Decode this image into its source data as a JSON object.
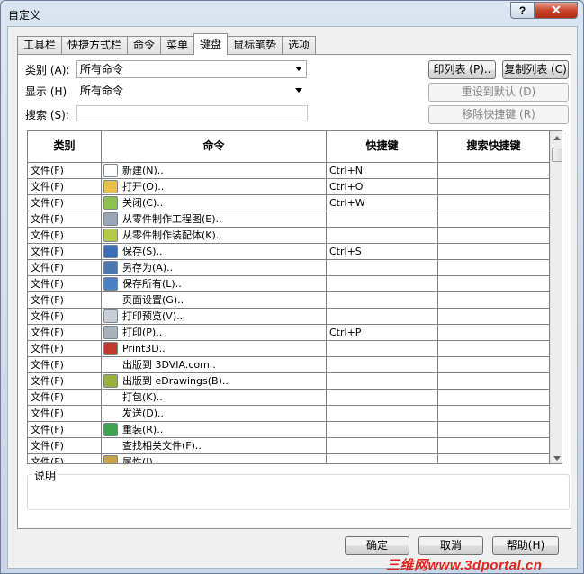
{
  "window": {
    "title": "自定义",
    "help_label": "?",
    "close_label": "✕"
  },
  "tabs": [
    {
      "label": "工具栏"
    },
    {
      "label": "快捷方式栏"
    },
    {
      "label": "命令"
    },
    {
      "label": "菜单"
    },
    {
      "label": "键盘"
    },
    {
      "label": "鼠标笔势"
    },
    {
      "label": "选项"
    }
  ],
  "active_tab_index": 4,
  "filters": {
    "category_label": "类别 (A):",
    "category_value": "所有命令",
    "show_label": "显示 (H)",
    "show_value": "所有命令",
    "search_label": "搜索 (S):",
    "search_value": ""
  },
  "buttons": {
    "print_list": "印列表 (P)..",
    "copy_list": "复制列表 (C)",
    "reset_default": "重设到默认 (D)",
    "remove_shortcut": "移除快捷键 (R)",
    "ok": "确定",
    "cancel": "取消",
    "help": "帮助(H)"
  },
  "table": {
    "headers": [
      "类别",
      "命令",
      "快捷键",
      "搜索快捷键"
    ],
    "rows": [
      {
        "category": "文件(F)",
        "command": "新建(N)..",
        "shortcut": "Ctrl+N",
        "search": "",
        "icon": "new-document-icon",
        "color": "#ffffff"
      },
      {
        "category": "文件(F)",
        "command": "打开(O)..",
        "shortcut": "Ctrl+O",
        "search": "",
        "icon": "open-folder-icon",
        "color": "#e8c04a"
      },
      {
        "category": "文件(F)",
        "command": "关闭(C)..",
        "shortcut": "Ctrl+W",
        "search": "",
        "icon": "close-folder-icon",
        "color": "#8dc04c"
      },
      {
        "category": "文件(F)",
        "command": "从零件制作工程图(E)..",
        "shortcut": "",
        "search": "",
        "icon": "make-drawing-icon",
        "color": "#9aa6b4"
      },
      {
        "category": "文件(F)",
        "command": "从零件制作装配体(K)..",
        "shortcut": "",
        "search": "",
        "icon": "make-assembly-icon",
        "color": "#b5c94a"
      },
      {
        "category": "文件(F)",
        "command": "保存(S)..",
        "shortcut": "Ctrl+S",
        "search": "",
        "icon": "save-icon",
        "color": "#3a6fb8"
      },
      {
        "category": "文件(F)",
        "command": "另存为(A)..",
        "shortcut": "",
        "search": "",
        "icon": "save-as-icon",
        "color": "#4a78b0"
      },
      {
        "category": "文件(F)",
        "command": "保存所有(L)..",
        "shortcut": "",
        "search": "",
        "icon": "save-all-icon",
        "color": "#4d7fc4"
      },
      {
        "category": "文件(F)",
        "command": "页面设置(G)..",
        "shortcut": "",
        "search": "",
        "icon": "",
        "color": ""
      },
      {
        "category": "文件(F)",
        "command": "打印预览(V)..",
        "shortcut": "",
        "search": "",
        "icon": "print-preview-icon",
        "color": "#c8ced6"
      },
      {
        "category": "文件(F)",
        "command": "打印(P)..",
        "shortcut": "Ctrl+P",
        "search": "",
        "icon": "print-icon",
        "color": "#a9b1ba"
      },
      {
        "category": "文件(F)",
        "command": "Print3D..",
        "shortcut": "",
        "search": "",
        "icon": "print3d-icon",
        "color": "#c0392b"
      },
      {
        "category": "文件(F)",
        "command": "出版到 3DVIA.com..",
        "shortcut": "",
        "search": "",
        "icon": "",
        "color": ""
      },
      {
        "category": "文件(F)",
        "command": "出版到 eDrawings(B)..",
        "shortcut": "",
        "search": "",
        "icon": "edrawings-icon",
        "color": "#9cae3c"
      },
      {
        "category": "文件(F)",
        "command": "打包(K)..",
        "shortcut": "",
        "search": "",
        "icon": "",
        "color": ""
      },
      {
        "category": "文件(F)",
        "command": "发送(D)..",
        "shortcut": "",
        "search": "",
        "icon": "",
        "color": ""
      },
      {
        "category": "文件(F)",
        "command": "重装(R)..",
        "shortcut": "",
        "search": "",
        "icon": "reload-icon",
        "color": "#3fa34d"
      },
      {
        "category": "文件(F)",
        "command": "查找相关文件(F)..",
        "shortcut": "",
        "search": "",
        "icon": "",
        "color": ""
      },
      {
        "category": "文件(F)",
        "command": "属性(I)..",
        "shortcut": "",
        "search": "",
        "icon": "properties-icon",
        "color": "#c9a14a"
      }
    ]
  },
  "description": {
    "label": "说明",
    "text": ""
  },
  "watermark": "三维网www.3dportal.cn"
}
